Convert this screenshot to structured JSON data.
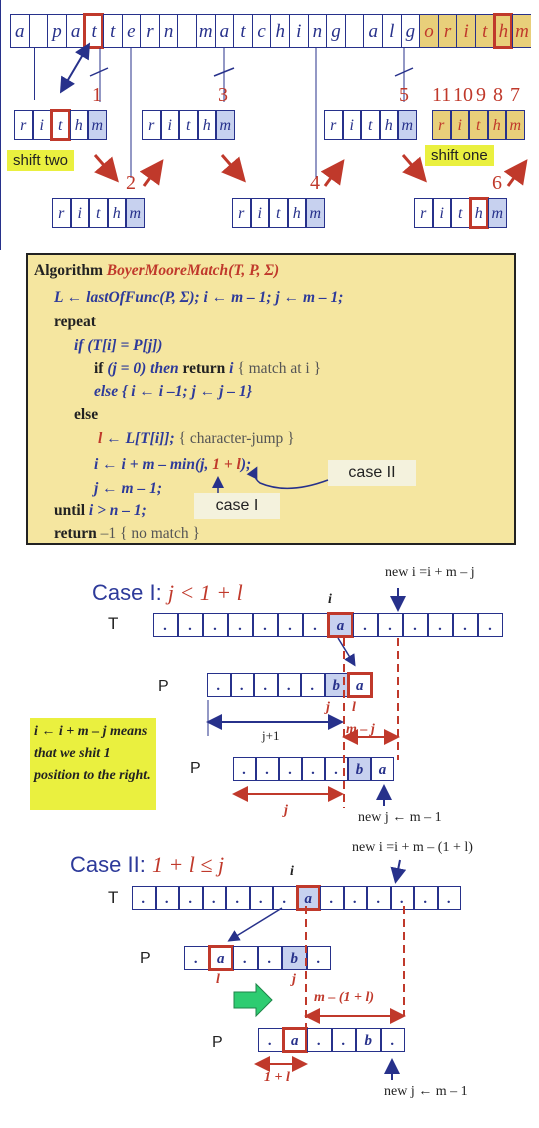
{
  "text_row": [
    "a",
    " ",
    "p",
    "a",
    "t",
    "t",
    "e",
    "r",
    "n",
    " ",
    "m",
    "a",
    "t",
    "c",
    "h",
    "i",
    "n",
    "g",
    " ",
    "a",
    "l",
    "g",
    "o",
    "r",
    "i",
    "t",
    "h",
    "m"
  ],
  "pattern": [
    "r",
    "i",
    "t",
    "h",
    "m"
  ],
  "top": {
    "numbers": [
      "1",
      "2",
      "3",
      "4",
      "5",
      "6",
      "11",
      "10",
      "9",
      "8",
      "7"
    ],
    "shift_two": "shift two",
    "shift_one": "shift one"
  },
  "algorithm": {
    "line0_kw": "Algorithm",
    "line0_name": "BoyerMooreMatch",
    "line0_args": "(T, P, Σ)",
    "line1": "L ← lastOfFunc(P, Σ);  i ← m – 1; j ← m – 1;",
    "repeat": "repeat",
    "if1": "if (T[i] = P[j])",
    "if2_a": "if",
    "if2_b": "(j = 0)  then",
    "if2_return": "return",
    "if2_c": "i",
    "if2_comment": "{ match at i }",
    "else1": "else { i ← i –1;  j ← j – 1}",
    "else2": "else",
    "lline_l": "l",
    "lline_rest": "← L[T[i]];",
    "lline_comment": "{ character-jump }",
    "iline": "i ← i + m – min(j,",
    "iline_red": "1 + l",
    "iline_end": ");",
    "jline": "j ← m – 1;",
    "until_kw": "until",
    "until_rest": "i > n – 1;",
    "return_kw": "return",
    "return_rest": "–1",
    "return_comment": "{ no match }",
    "case1": "case I",
    "case2": "case II"
  },
  "case1": {
    "title_a": "Case I:",
    "title_b": "j < 1 + l",
    "T": "T",
    "P": "P",
    "i": "i",
    "new_i": "new i =i + m – j",
    "T_cells": [
      ".",
      ".",
      ".",
      ".",
      ".",
      ".",
      ".",
      "a",
      ".",
      ".",
      ".",
      ".",
      ".",
      "."
    ],
    "P1_cells": [
      ".",
      ".",
      ".",
      ".",
      ".",
      "b",
      "a"
    ],
    "P2_cells": [
      ".",
      ".",
      ".",
      ".",
      ".",
      "b",
      "a"
    ],
    "j_lbl": "j",
    "l_lbl": "l",
    "jplus1": "j+1",
    "mminusj": "m – j",
    "j2": "j",
    "new_j": "new j ← m – 1",
    "note": "i ← i + m – j means that we shit 1 position to the right."
  },
  "case2": {
    "title_a": "Case II:",
    "title_b": "1 + l ≤ j",
    "T": "T",
    "P": "P",
    "i": "i",
    "new_i": "new i =i + m – (1 + l)",
    "T_cells": [
      ".",
      ".",
      ".",
      ".",
      ".",
      ".",
      ".",
      "a",
      ".",
      ".",
      ".",
      ".",
      ".",
      "."
    ],
    "P1_cells": [
      ".",
      "a",
      ".",
      ".",
      "b",
      "."
    ],
    "P2_cells": [
      ".",
      "a",
      ".",
      ".",
      "b",
      "."
    ],
    "l_lbl": "l",
    "j_lbl": "j",
    "m1l": "m – (1 + l)",
    "onel": "1 + l",
    "new_j": "new j ← m – 1"
  },
  "colors": {
    "blue": "#27318b",
    "red": "#c0392b",
    "yellow": "#eaf03f",
    "algo_bg": "#f5e6a0"
  }
}
